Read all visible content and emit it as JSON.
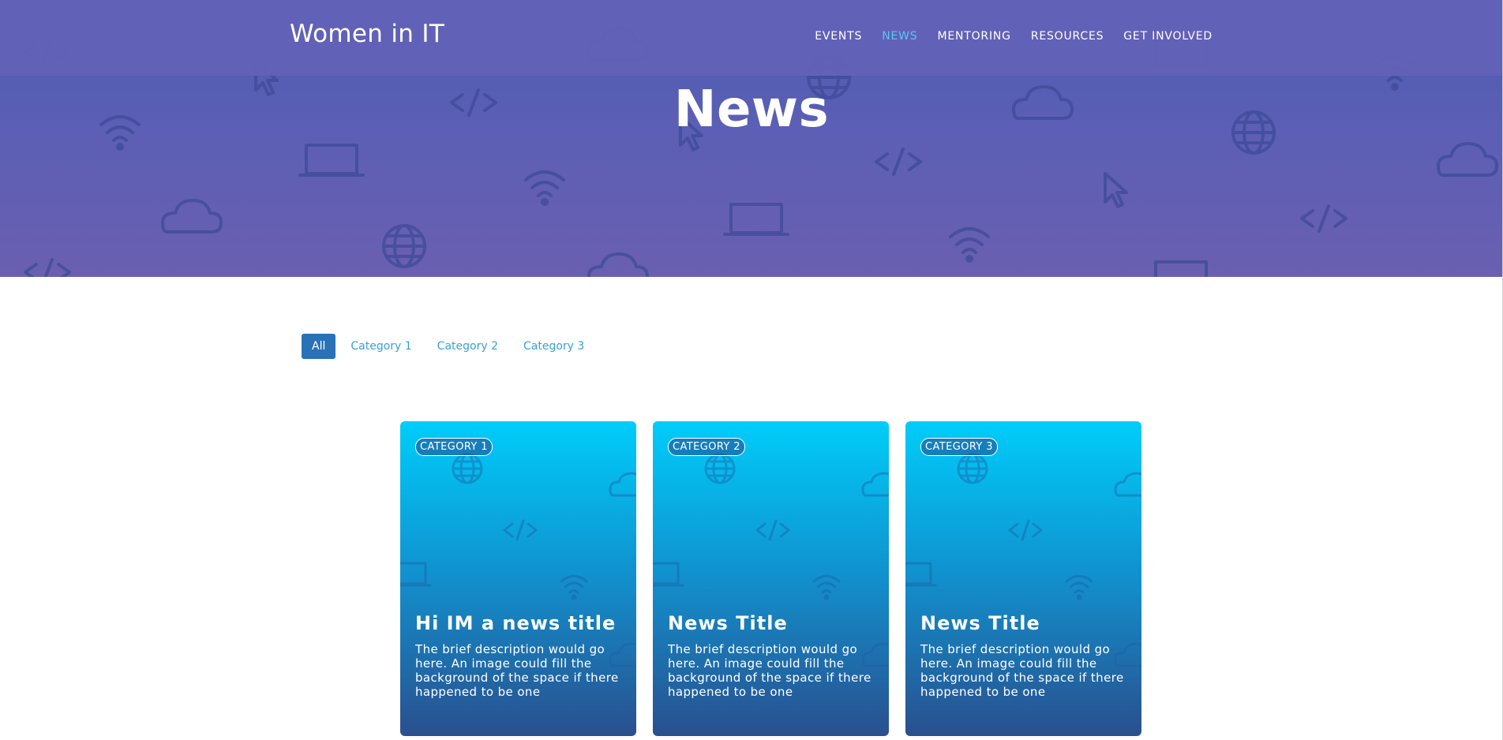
{
  "header": {
    "brand": "Women in IT",
    "nav": [
      {
        "label": "EVENTS",
        "active": false
      },
      {
        "label": "NEWS",
        "active": true
      },
      {
        "label": "MENTORING",
        "active": false
      },
      {
        "label": "RESOURCES",
        "active": false
      },
      {
        "label": "GET INVOLVED",
        "active": false
      }
    ]
  },
  "hero": {
    "title": "News",
    "icons": [
      "code-icon",
      "wifi-icon",
      "laptop-icon",
      "cloud-icon",
      "globe-icon",
      "cursor-icon"
    ]
  },
  "filters": [
    {
      "label": "All",
      "active": true
    },
    {
      "label": "Category 1",
      "active": false
    },
    {
      "label": "Category 2",
      "active": false
    },
    {
      "label": "Category 3",
      "active": false
    }
  ],
  "cards": [
    {
      "category": "CATEGORY 1",
      "title": "Hi IM a news title",
      "description": "The brief description would go here. An image could fill the background of the space if there happened to be one"
    },
    {
      "category": "CATEGORY 2",
      "title": "News Title",
      "description": "The brief description would go here. An image could fill the background of the space if there happened to be one"
    },
    {
      "category": "CATEGORY 3",
      "title": "News Title",
      "description": "The brief description would go here. An image could fill the background of the space if there happened to be one"
    }
  ],
  "colors": {
    "hero_top": "#4a5bb0",
    "hero_bottom": "#6a5fb0",
    "nav_active": "#5ac8f0",
    "filter_active_bg": "#2a72b8",
    "filter_link": "#3aa0d8",
    "card_top": "#00cdfa",
    "card_bottom": "#2a4f8e"
  }
}
